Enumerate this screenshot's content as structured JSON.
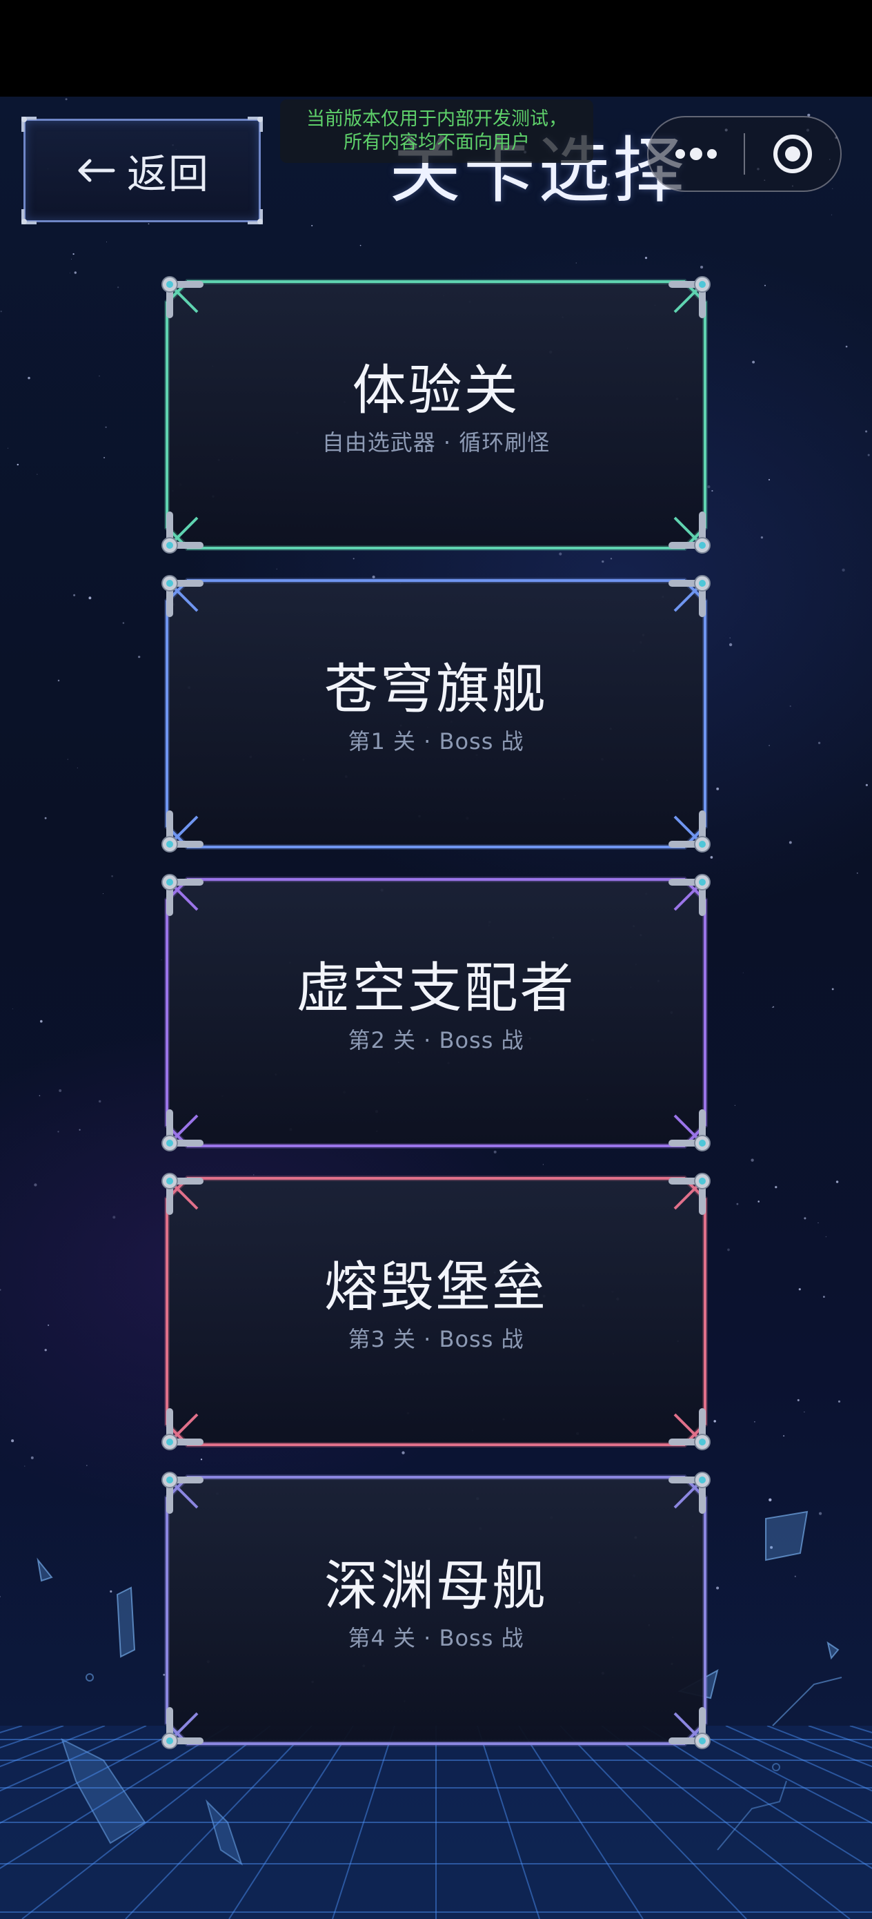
{
  "header": {
    "back_label": "返回",
    "title": "关卡选择",
    "dev_notice_line1": "当前版本仅用于内部开发测试，",
    "dev_notice_line2": "所有内容均不面向用户"
  },
  "capsule": {
    "more_icon": "more-dots-icon",
    "close_icon": "target-circle-icon"
  },
  "levels": [
    {
      "name": "体验关",
      "subtitle": "自由选武器 · 循环刷怪",
      "color": "#5fd3b0"
    },
    {
      "name": "苍穹旗舰",
      "subtitle": "第1 关 · Boss 战",
      "color": "#6f95f0"
    },
    {
      "name": "虚空支配者",
      "subtitle": "第2 关 · Boss 战",
      "color": "#9a74e8"
    },
    {
      "name": "熔毁堡垒",
      "subtitle": "第3 关 · Boss 战",
      "color": "#e0708a"
    },
    {
      "name": "深渊母舰",
      "subtitle": "第4 关 · Boss 战",
      "color": "#8b86e0"
    }
  ]
}
